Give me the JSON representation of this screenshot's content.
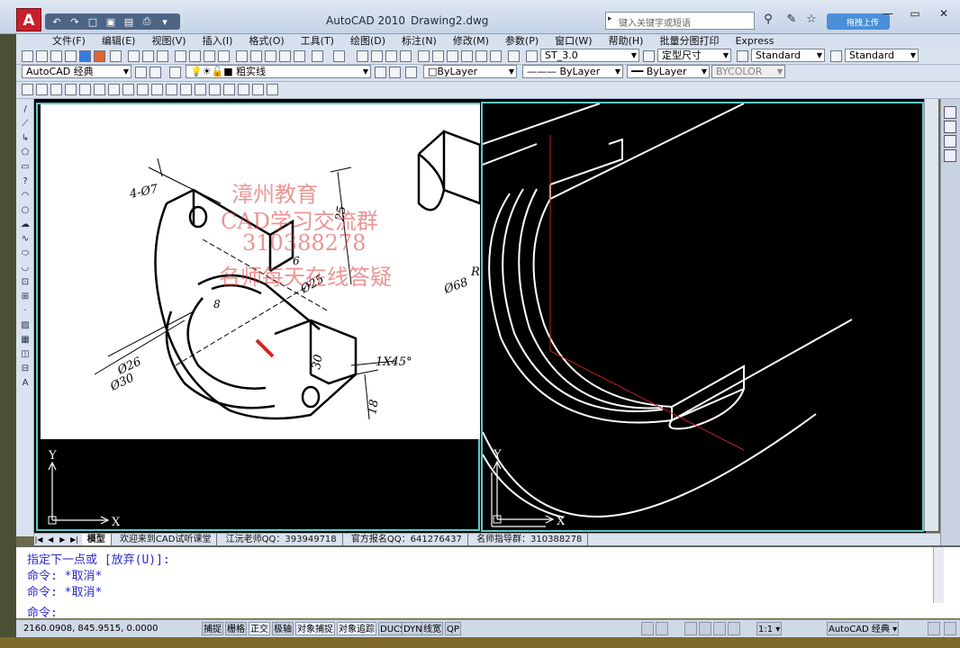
{
  "title_bar": {
    "app_name": "AutoCAD 2010",
    "document_name": "Drawing2.dwg",
    "search_placeholder": "键入关键字或短语",
    "upload_label": "拖拽上传",
    "logo_letter": "A"
  },
  "menu": [
    "文件(F)",
    "编辑(E)",
    "视图(V)",
    "插入(I)",
    "格式(O)",
    "工具(T)",
    "绘图(D)",
    "标注(N)",
    "修改(M)",
    "参数(P)",
    "窗口(W)",
    "帮助(H)",
    "批量分图打印",
    "Express"
  ],
  "toolbar_row1": {
    "text_style": "ST_3.0",
    "dim_style": "定型尺寸",
    "table_style": "Standard",
    "multileader_style": "Standard"
  },
  "toolbar_row2": {
    "workspace": "AutoCAD 经典",
    "layer": "粗实线",
    "color": "ByLayer",
    "linetype": "ByLayer",
    "lineweight": "ByLayer",
    "plot_style": "BYCOLOR"
  },
  "viewports": {
    "left_axis_x": "X",
    "left_axis_y": "Y",
    "right_axis_x": "X",
    "right_axis_y": "Y"
  },
  "reference_drawing": {
    "dim_holes": "4-Ø7",
    "dim_25": "25",
    "dim_6": "6",
    "dim_8": "8",
    "dim_phi25": "Ø25",
    "dim_phi26": "Ø26",
    "dim_phi30": "Ø30",
    "dim_phi68": "Ø68",
    "dim_chamfer": "1X45°",
    "dim_18": "18",
    "dim_30": "30",
    "dim_r": "R",
    "watermark_lines": [
      "漳州教育",
      "CAD学习交流群",
      "310388278",
      "名师每天在线答疑"
    ]
  },
  "tabs": {
    "model": "模型",
    "layout_tabs": [
      "欢迎来到CAD试听课堂",
      "江沅老师QQ：393949718",
      "官方报名QQ：641276437",
      "名师指导群：310388278"
    ]
  },
  "command_history": [
    "指定下一点或 [放弃(U)]:",
    "命令: *取消*",
    "命令: *取消*"
  ],
  "command_prompt": "命令:",
  "status_bar": {
    "coordinates": "2160.0908, 845.9515, 0.0000",
    "toggles": [
      {
        "label": "捕捉",
        "on": false
      },
      {
        "label": "栅格",
        "on": false
      },
      {
        "label": "正交",
        "on": true
      },
      {
        "label": "极轴",
        "on": false
      },
      {
        "label": "对象捕捉",
        "on": true
      },
      {
        "label": "对象追踪",
        "on": true
      },
      {
        "label": "DUCS",
        "on": false
      },
      {
        "label": "DYN",
        "on": false
      },
      {
        "label": "线宽",
        "on": false
      },
      {
        "label": "QP",
        "on": false
      }
    ],
    "annotation_scale": "1:1",
    "workspace_label": "AutoCAD 经典"
  },
  "colors": {
    "viewport_border": "#5dc9c9",
    "command_text": "#2a2acc",
    "ucs_red": "#c0201a"
  }
}
